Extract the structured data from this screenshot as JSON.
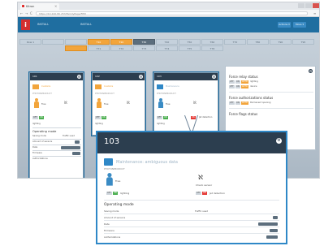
{
  "browser": {
    "tab_title": "Kitron",
    "tab_close": "×",
    "address": "https://10.240.80.253/FamilyPage/FPM",
    "nav_back": "←",
    "nav_forward": "→",
    "nav_reload": "C",
    "menu_icon": "≡"
  },
  "app": {
    "logo": "i",
    "topnav": [
      "INSTALL",
      "",
      "INSTALL"
    ],
    "btn_a": "Actions ▾",
    "btn_b": "More ▾",
    "grid_row1": [
      "Row 1",
      "",
      "",
      "T10",
      "T20",
      "T30",
      "T40",
      "T50",
      "T60",
      "T70",
      "T80",
      "T90",
      "T95"
    ],
    "grid_row2": [
      "",
      "T71",
      "T72",
      "T73",
      "T74",
      "T75",
      "T76"
    ]
  },
  "cards": [
    {
      "num": "101",
      "mode": "Customs",
      "sub": "PHOTONPRODUCT",
      "person": "Free",
      "badge": "ACL 2",
      "label": "lighting",
      "op_title": "Operating mode",
      "rows": [
        "Saving mode",
        "Amount of sensors",
        "Date",
        "Firmware",
        "Authorizations"
      ],
      "vals": [
        "Traffic used"
      ]
    },
    {
      "num": "102",
      "mode": "Customs",
      "sub": "PHOTONPRODUCT",
      "person": "Free",
      "badge": "ACL 2",
      "label": "lighting"
    },
    {
      "num": "103",
      "mode": "Maintenance",
      "sub": "PHOTONPRODUCT",
      "person": "Free",
      "label": "lighting",
      "extra": "Jet detection"
    }
  ],
  "big_card": {
    "num": "103",
    "title": "Maintenance: ambiguous data",
    "sub": "PHOTONPRODUCT",
    "person_label": "Free",
    "lux_label": "Check sensor",
    "pill1_a": "OFF",
    "pill1_b": "ON",
    "pill1_text": "lighting",
    "pill2_a": "OFF",
    "pill2_text": "Jet detection",
    "section": "Operating mode",
    "rows": [
      {
        "label": "Saving mode",
        "val": "Traffic used"
      },
      {
        "label": "Amount of sensors",
        "val": ""
      },
      {
        "label": "Date",
        "val": ""
      },
      {
        "label": "Firmware",
        "val": ""
      },
      {
        "label": "Authorizations",
        "val": ""
      }
    ]
  },
  "right_panel": {
    "sections": [
      {
        "title": "Force relay status",
        "pills": [
          "OFF",
          "ON",
          "AUTO",
          "lighting"
        ],
        "pills2": [
          "OFF",
          "ON",
          "AUTO",
          "device"
        ]
      },
      {
        "title": "Force authorizations status",
        "pills": [
          "OFF",
          "ON",
          "AUTO",
          "Permanent opening"
        ]
      },
      {
        "title": "Force flags status",
        "pills": []
      }
    ],
    "close": "×"
  },
  "colors": {
    "header": "#1f6ea0",
    "card_head": "#2c3e4f",
    "accent_orange": "#f2a53c",
    "accent_green": "#4caf50",
    "accent_red": "#e53935",
    "accent_blue": "#2f88c7"
  }
}
